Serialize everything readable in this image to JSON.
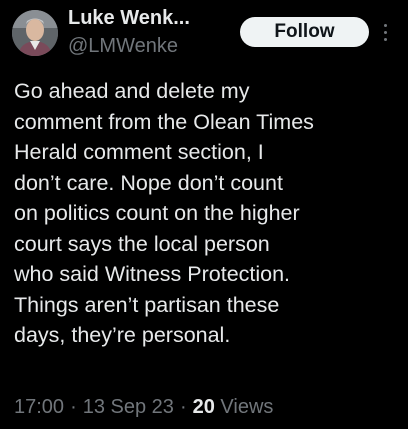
{
  "author": {
    "display_name": "Luke Wenk...",
    "handle": "@LMWenke"
  },
  "actions": {
    "follow_label": "Follow",
    "more_icon": "more-vertical-icon"
  },
  "tweet": {
    "text": "Go ahead and delete my\ncomment from the Olean Times\nHerald comment section, I\ndon’t care.  Nope don’t count\non politics count on the higher\ncourt says the local person\nwho said Witness Protection.\nThings aren’t partisan these\ndays, they’re personal."
  },
  "meta": {
    "time": "17:00",
    "separator": "·",
    "date": "13 Sep 23",
    "views_count": "20",
    "views_label": "Views"
  },
  "colors": {
    "background": "#000000",
    "primary_text": "#e7e9ea",
    "secondary_text": "#71767b",
    "follow_button_bg": "#eff3f4"
  }
}
